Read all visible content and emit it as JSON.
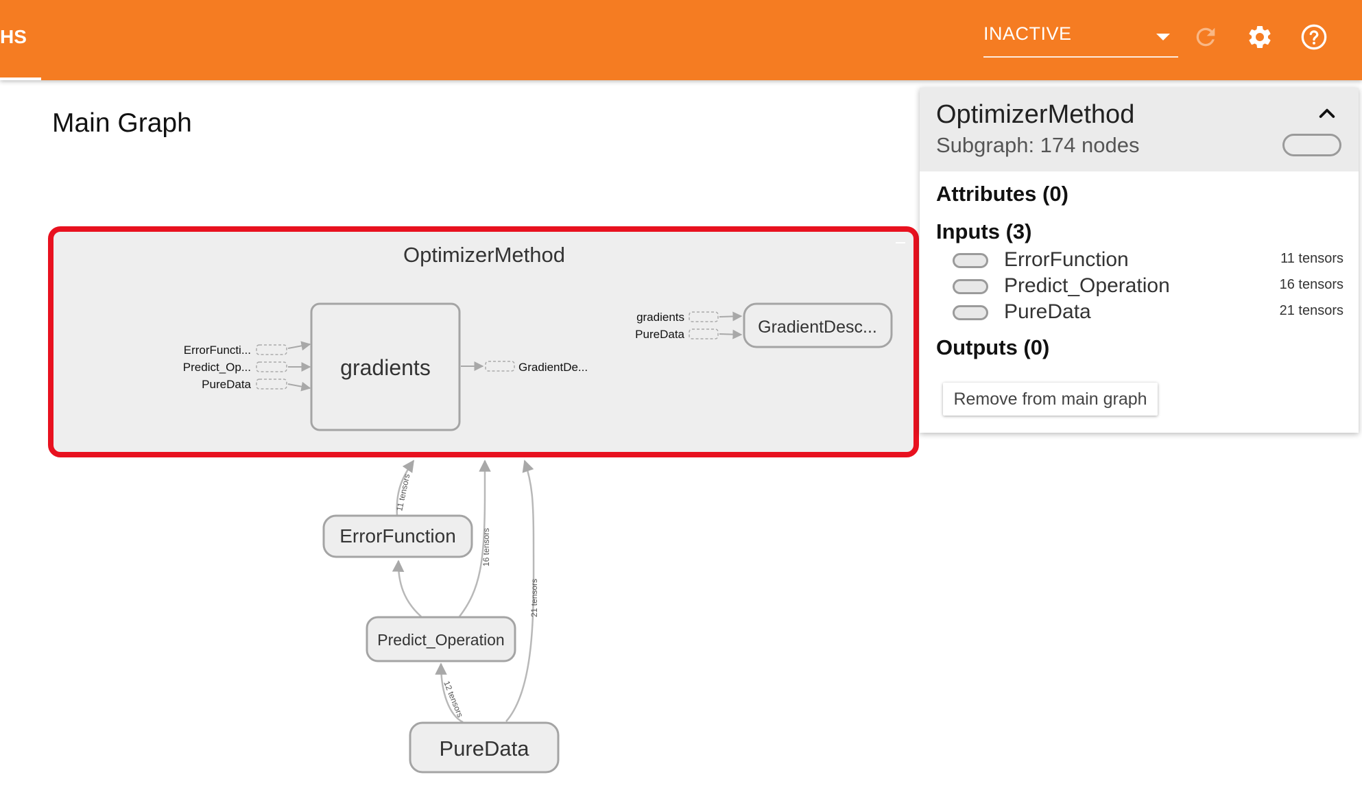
{
  "header": {
    "tab_label": "HS",
    "run_select": {
      "value": "INACTIVE"
    },
    "icons": [
      "refresh-icon",
      "gear-icon",
      "help-icon"
    ],
    "accent_color": "#f57c22"
  },
  "page_title": "Main Graph",
  "graph": {
    "selected_node": {
      "title": "OptimizerMethod",
      "highlight_color": "#e8111f",
      "inner": {
        "gradients_label": "gradients",
        "left_inputs": [
          "ErrorFuncti...",
          "Predict_Op...",
          "PureData"
        ],
        "right_output": "GradientDe...",
        "gd_inputs": [
          "gradients",
          "PureData"
        ],
        "gd_node_label": "GradientDesc..."
      }
    },
    "nodes": {
      "error_function": "ErrorFunction",
      "predict_operation": "Predict_Operation",
      "pure_data": "PureData"
    },
    "edges": {
      "e11": "11 tensors",
      "e16": "16 tensors",
      "e21": "21 tensors",
      "e12": "12 tensors"
    }
  },
  "info_card": {
    "title": "OptimizerMethod",
    "subtitle": "Subgraph: 174 nodes",
    "attributes_heading": "Attributes (0)",
    "inputs_heading": "Inputs (3)",
    "inputs": [
      {
        "name": "ErrorFunction",
        "count": "11 tensors"
      },
      {
        "name": "Predict_Operation",
        "count": "16 tensors"
      },
      {
        "name": "PureData",
        "count": "21 tensors"
      }
    ],
    "outputs_heading": "Outputs (0)",
    "remove_button": "Remove from main graph"
  }
}
